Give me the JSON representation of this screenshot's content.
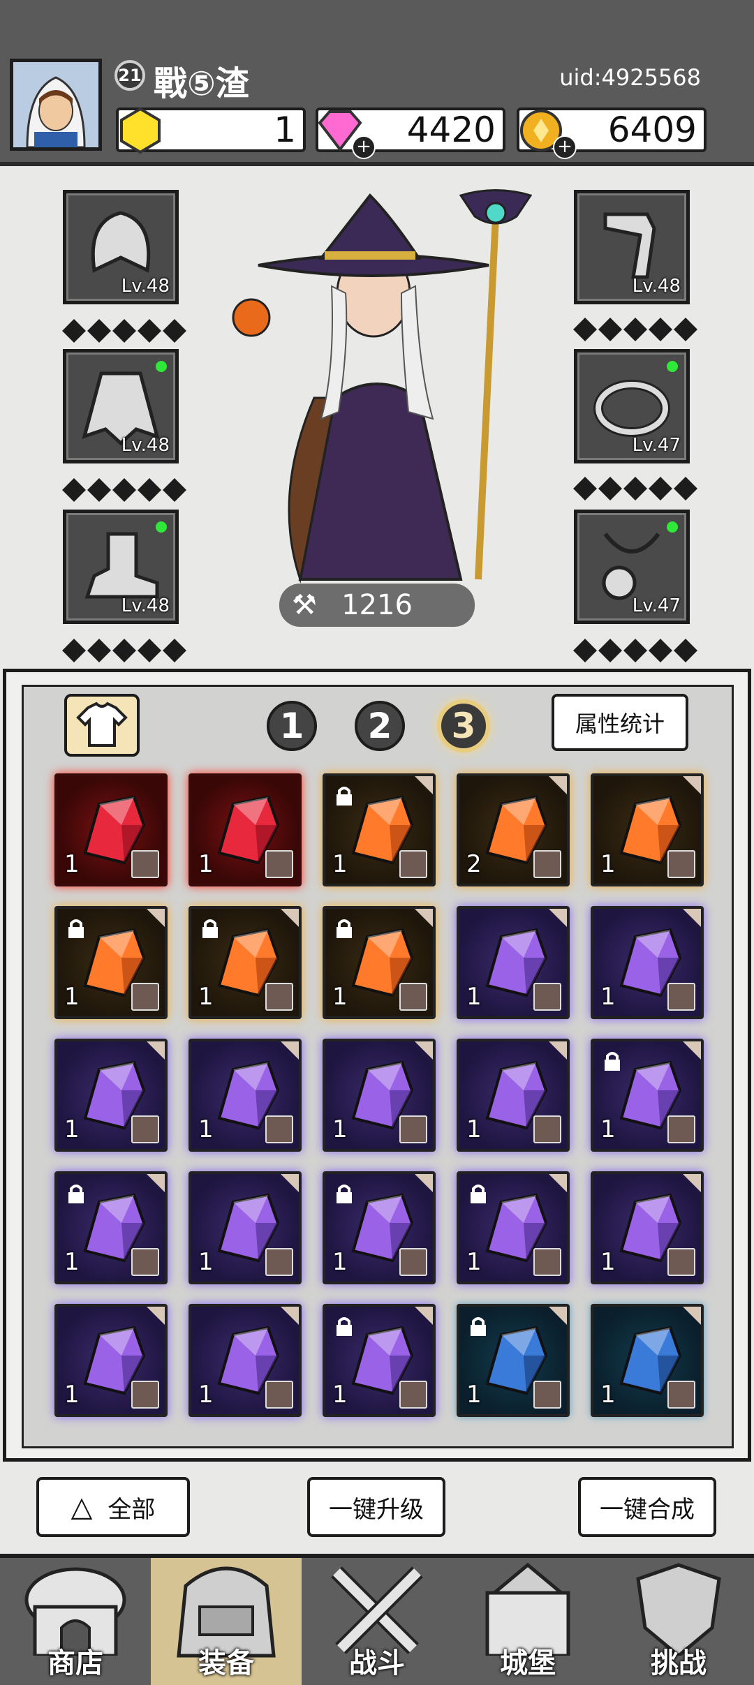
{
  "player": {
    "level": "21",
    "name": "戰⑤渣",
    "uid": "uid:4925568"
  },
  "resources": {
    "gem_yellow": "1",
    "diamond": "4420",
    "gold": "6409"
  },
  "equipment": {
    "left": [
      {
        "name": "helmet",
        "level": "Lv.48",
        "new": false
      },
      {
        "name": "cloak",
        "level": "Lv.48",
        "new": true
      },
      {
        "name": "boots",
        "level": "Lv.48",
        "new": true
      }
    ],
    "right": [
      {
        "name": "weapon",
        "level": "Lv.48",
        "new": false
      },
      {
        "name": "ring",
        "level": "Lv.47",
        "new": true
      },
      {
        "name": "necklace",
        "level": "Lv.47",
        "new": true
      }
    ]
  },
  "power": "1216",
  "tabs": {
    "t1": "1",
    "t2": "2",
    "t3": "3",
    "active": "3",
    "attr_button": "属性统计"
  },
  "items": [
    {
      "rarity": "red",
      "count": "1",
      "lock": false
    },
    {
      "rarity": "red",
      "count": "1",
      "lock": false
    },
    {
      "rarity": "orange",
      "count": "1",
      "lock": true
    },
    {
      "rarity": "orange",
      "count": "2",
      "lock": false
    },
    {
      "rarity": "orange",
      "count": "1",
      "lock": false
    },
    {
      "rarity": "orange",
      "count": "1",
      "lock": true
    },
    {
      "rarity": "orange",
      "count": "1",
      "lock": true
    },
    {
      "rarity": "orange",
      "count": "1",
      "lock": true
    },
    {
      "rarity": "purple",
      "count": "1",
      "lock": false
    },
    {
      "rarity": "purple",
      "count": "1",
      "lock": false
    },
    {
      "rarity": "purple",
      "count": "1",
      "lock": false
    },
    {
      "rarity": "purple",
      "count": "1",
      "lock": false
    },
    {
      "rarity": "purple",
      "count": "1",
      "lock": false
    },
    {
      "rarity": "purple",
      "count": "1",
      "lock": false
    },
    {
      "rarity": "purple",
      "count": "1",
      "lock": true
    },
    {
      "rarity": "purple",
      "count": "1",
      "lock": true
    },
    {
      "rarity": "purple",
      "count": "1",
      "lock": false
    },
    {
      "rarity": "purple",
      "count": "1",
      "lock": true
    },
    {
      "rarity": "purple",
      "count": "1",
      "lock": true
    },
    {
      "rarity": "purple",
      "count": "1",
      "lock": false
    },
    {
      "rarity": "purple",
      "count": "1",
      "lock": false
    },
    {
      "rarity": "purple",
      "count": "1",
      "lock": false
    },
    {
      "rarity": "purple",
      "count": "1",
      "lock": true
    },
    {
      "rarity": "blue",
      "count": "1",
      "lock": true
    },
    {
      "rarity": "blue",
      "count": "1",
      "lock": false
    }
  ],
  "actions": {
    "filter": "全部",
    "upgrade": "一键升级",
    "merge": "一键合成"
  },
  "nav": [
    {
      "label": "商店",
      "active": false
    },
    {
      "label": "装备",
      "active": true
    },
    {
      "label": "战斗",
      "active": false
    },
    {
      "label": "城堡",
      "active": false
    },
    {
      "label": "挑战",
      "active": false
    }
  ],
  "colors": {
    "accent_nav_active": "#d6c394",
    "new_dot": "#2ee83a"
  }
}
